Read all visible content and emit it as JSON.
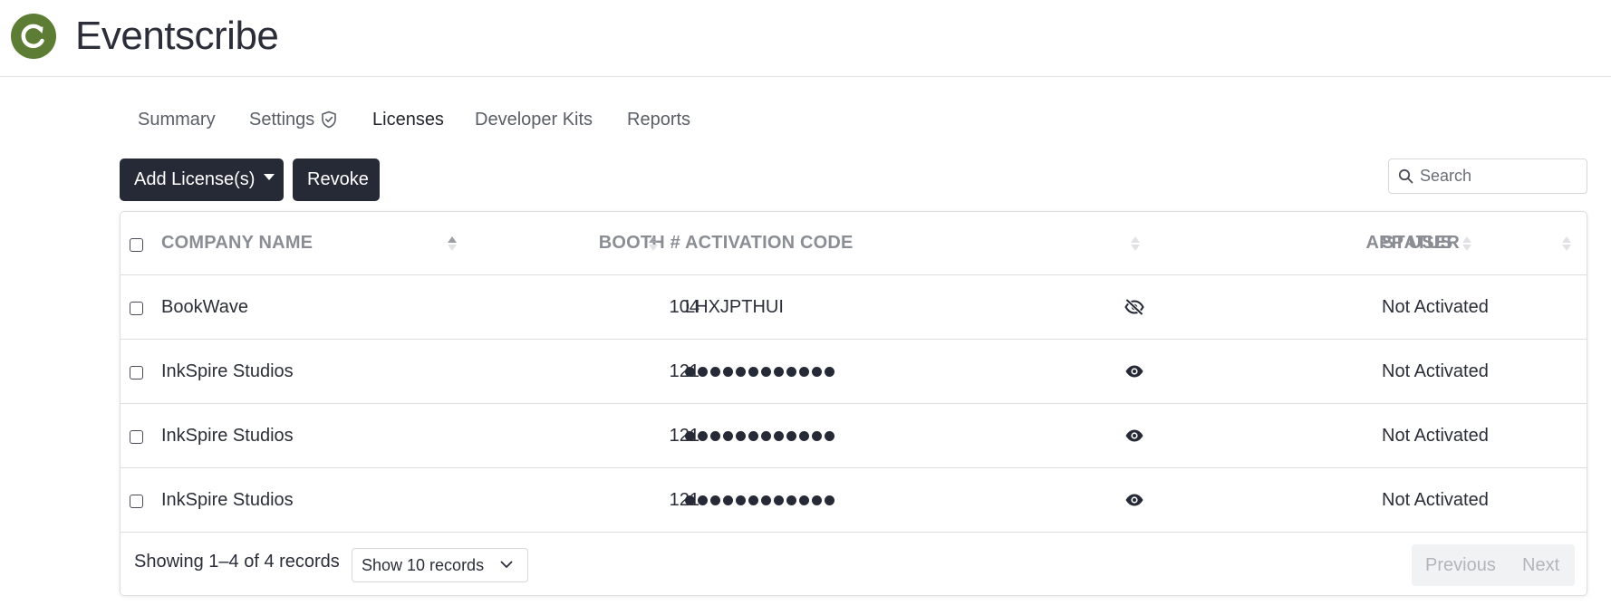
{
  "app": {
    "title": "Eventscribe",
    "logo_letter": "C",
    "brand_color": "#5d7d34"
  },
  "tabs": [
    {
      "label": "Summary",
      "active": false
    },
    {
      "label": "Settings",
      "active": false,
      "icon": "shield-check-icon"
    },
    {
      "label": "Licenses",
      "active": true
    },
    {
      "label": "Developer Kits",
      "active": false
    },
    {
      "label": "Reports",
      "active": false
    }
  ],
  "toolbar": {
    "add_label": "Add License(s)",
    "revoke_label": "Revoke",
    "search_placeholder": "Search",
    "search_value": ""
  },
  "table": {
    "headers": {
      "company": "COMPANY NAME",
      "booth": "BOOTH #",
      "code": "ACTIVATION CODE",
      "app_user": "APP USER",
      "status": "STATUS"
    },
    "rows": [
      {
        "company": "BookWave",
        "booth": "104",
        "code": "LHXJPTHUI",
        "code_visible": true,
        "app_user": "",
        "status": "Not Activated"
      },
      {
        "company": "InkSpire Studios",
        "booth": "121",
        "code": "●●●●●●●●●●●●",
        "code_visible": false,
        "app_user": "",
        "status": "Not Activated"
      },
      {
        "company": "InkSpire Studios",
        "booth": "121",
        "code": "●●●●●●●●●●●●",
        "code_visible": false,
        "app_user": "",
        "status": "Not Activated"
      },
      {
        "company": "InkSpire Studios",
        "booth": "121",
        "code": "●●●●●●●●●●●●",
        "code_visible": false,
        "app_user": "",
        "status": "Not Activated"
      }
    ]
  },
  "footer": {
    "records_text": "Showing 1–4 of 4 records",
    "page_size_label": "Show 10 records",
    "prev_label": "Previous",
    "next_label": "Next"
  }
}
